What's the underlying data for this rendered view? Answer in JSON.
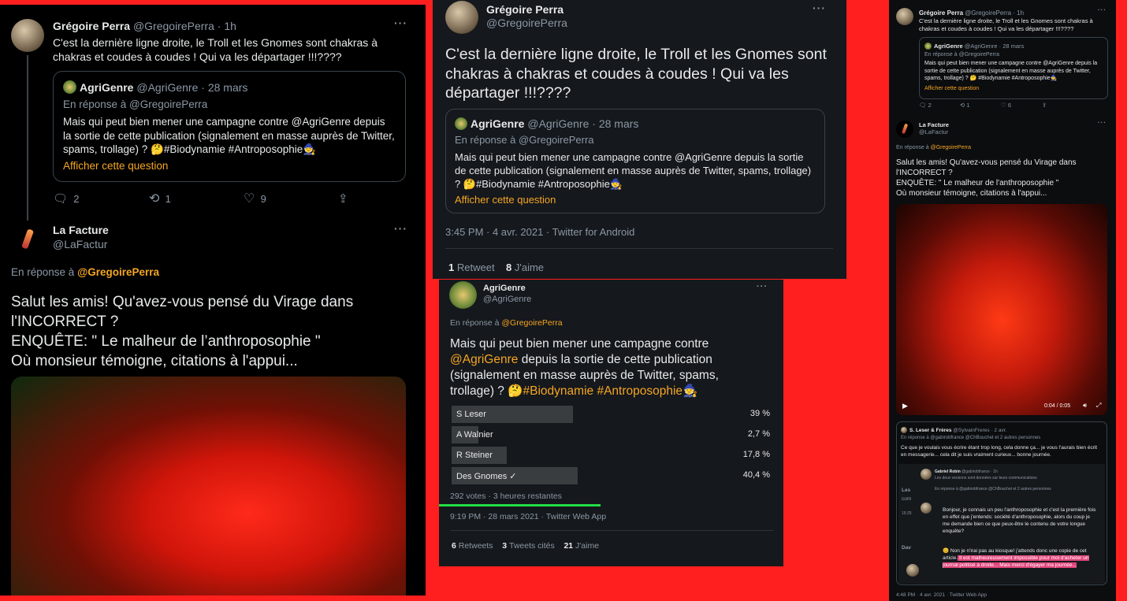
{
  "colors": {
    "background": "#ff1f1f",
    "panel": "#000000",
    "accent": "#f5a623",
    "muted": "#8b98a5",
    "highlight": "#e0457a",
    "green_line": "#22dd44"
  },
  "p1": {
    "author": "Grégoire Perra",
    "handle": "@GregoirePerra",
    "time": "· 1h",
    "text": "C'est la dernière ligne droite, le Troll et les Gnomes sont chakras à chakras et coudes à coudes ! Qui va les départager !!!????",
    "quote": {
      "author": "AgriGenre",
      "handle": "@AgriGenre",
      "time": "· 28 mars",
      "reply_to": "En réponse à @GregoirePerra",
      "text": "Mais qui peut bien mener une campagne contre @AgriGenre  depuis la sortie de cette publication  (signalement en masse auprès de Twitter, spams, trollage) ? 🤔#Biodynamie #Antroposophie🧙",
      "show": "Afficher cette question"
    },
    "actions": {
      "reply": "2",
      "retweet": "1",
      "like": "9"
    },
    "reply": {
      "author": "La Facture",
      "handle": "@LaFactur",
      "reply_prefix": "En réponse à ",
      "reply_to": "@GregoirePerra",
      "text": "Salut les amis! Qu'avez-vous pensé du Virage dans l'INCORRECT ?\n ENQUÊTE: \" Le malheur de l’anthroposophie \"\nOù monsieur témoigne, citations à l'appui..."
    }
  },
  "p2": {
    "author": "Grégoire Perra",
    "handle": "@GregoirePerra",
    "text": "C'est la dernière ligne droite, le Troll et les Gnomes sont chakras à chakras et coudes à coudes ! Qui va les départager !!!????",
    "quote": {
      "author": "AgriGenre",
      "handle": "@AgriGenre",
      "time": "· 28 mars",
      "reply_to": "En réponse à @GregoirePerra",
      "text": "Mais qui peut bien mener une campagne contre @AgriGenre  depuis la sortie de cette publication  (signalement en masse auprès de Twitter, spams, trollage) ? 🤔#Biodynamie #Antroposophie🧙",
      "show": "Afficher cette question"
    },
    "meta": "3:45 PM · 4 avr. 2021 · Twitter for Android",
    "stats": {
      "retweets_n": "1",
      "retweets_l": "Retweet",
      "likes_n": "8",
      "likes_l": "J'aime"
    }
  },
  "p3": {
    "author": "AgriGenre",
    "handle": "@AgriGenre",
    "reply_prefix": "En réponse à ",
    "reply_to": "@GregoirePerra",
    "text_a": "Mais qui peut bien mener une campagne contre ",
    "mention": "@AgriGenre",
    "text_b": "  depuis la sortie de cette publication (signalement en masse auprès de Twitter, spams, trollage) ? 🤔",
    "tags": "#Biodynamie #Antroposophie",
    "tail": "🧙",
    "poll": [
      {
        "label": "S Leser",
        "pct": "39 %",
        "value": 39
      },
      {
        "label": "A Walnier",
        "pct": "2,7 %",
        "value": 2.7
      },
      {
        "label": "R Steiner",
        "pct": "17,8 %",
        "value": 17.8
      },
      {
        "label": "Des Gnomes ✓",
        "pct": "40,4 %",
        "value": 40.4
      }
    ],
    "poll_meta": "292 votes · 3 heures restantes",
    "meta": "9:19 PM · 28 mars 2021 · Twitter Web App",
    "stats": {
      "retweets_n": "6",
      "retweets_l": "Retweets",
      "quotes_n": "3",
      "quotes_l": "Tweets cités",
      "likes_n": "21",
      "likes_l": "J'aime"
    }
  },
  "p4": {
    "author": "Grégoire Perra",
    "handle": "@GregoirePerra · 1h",
    "text": "C'est la dernière ligne droite, le Troll et les Gnomes sont chakras à chakras et coudes à coudes ! Qui va les départager !!!????",
    "quote": {
      "author": "AgriGenre",
      "handle": "@AgriGenre · 28 mars",
      "reply_to": "En réponse à @GregoirePerra",
      "text": "Mais qui peut bien mener une campagne contre @AgriGenre  depuis la sortie de cette publication  (signalement en masse auprès de Twitter, spams, trollage) ? 🤔 #Biodynamie #Antroposophie🧙",
      "show": "Afficher cette question"
    },
    "actions": {
      "reply": "2",
      "retweet": "1",
      "like": "6"
    },
    "reply": {
      "author": "La Facture",
      "handle": "@LaFactur",
      "reply_prefix": "En réponse à ",
      "reply_to": "@GregoirePerra",
      "text": "Salut les amis! Qu'avez-vous pensé du Virage dans l'INCORRECT ?\n ENQUÊTE: \" Le malheur de l'anthroposophie \"\nOù monsieur témoigne, citations à l'appui..."
    },
    "video_time": "0:04 / 0:05",
    "quote2": {
      "author": "S. Leser & Frères",
      "handle": "@SylvainFreres · 2 avr.",
      "reply": "En réponse à @gabirobfrance @ChBouchet et 2 autres personnes",
      "text": "Ce que je voulais vous écrire étant trop long, cela donne ça... je vous l'aurais bien écrit en messagerie... cela dit je suis vraiment curieux... bonne journée."
    },
    "inner": {
      "author": "Gabriel Robin",
      "handle": "@gabirobfrance · 1h",
      "line": "Les deux versions sont données sur leurs communications",
      "reply": "En réponse à @gabirobfrance @ChBouchet et 2 autres personnes",
      "text": "Bonjour, je connais un peu l'anthroposophie et c'est la première fois en effet que j'entends: société d'anthroposophie, alors du coup je me demande bien ce que peux-être le contenu de votre longue enquête?",
      "text2": "😊 Non je n'irai pas au kiosque! j'attends donc une copie de cet article.",
      "hl": " Il est malheureusement impossible pour moi d'acheter un journal politisé à droite... Mais merci d'égayer ma journée..."
    },
    "side_labels": {
      "les": "Les",
      "com": "com",
      "date": "15:25",
      "dav": "Dav"
    },
    "meta": "4:48 PM · 4 avr. 2021 · Twitter Web App"
  }
}
